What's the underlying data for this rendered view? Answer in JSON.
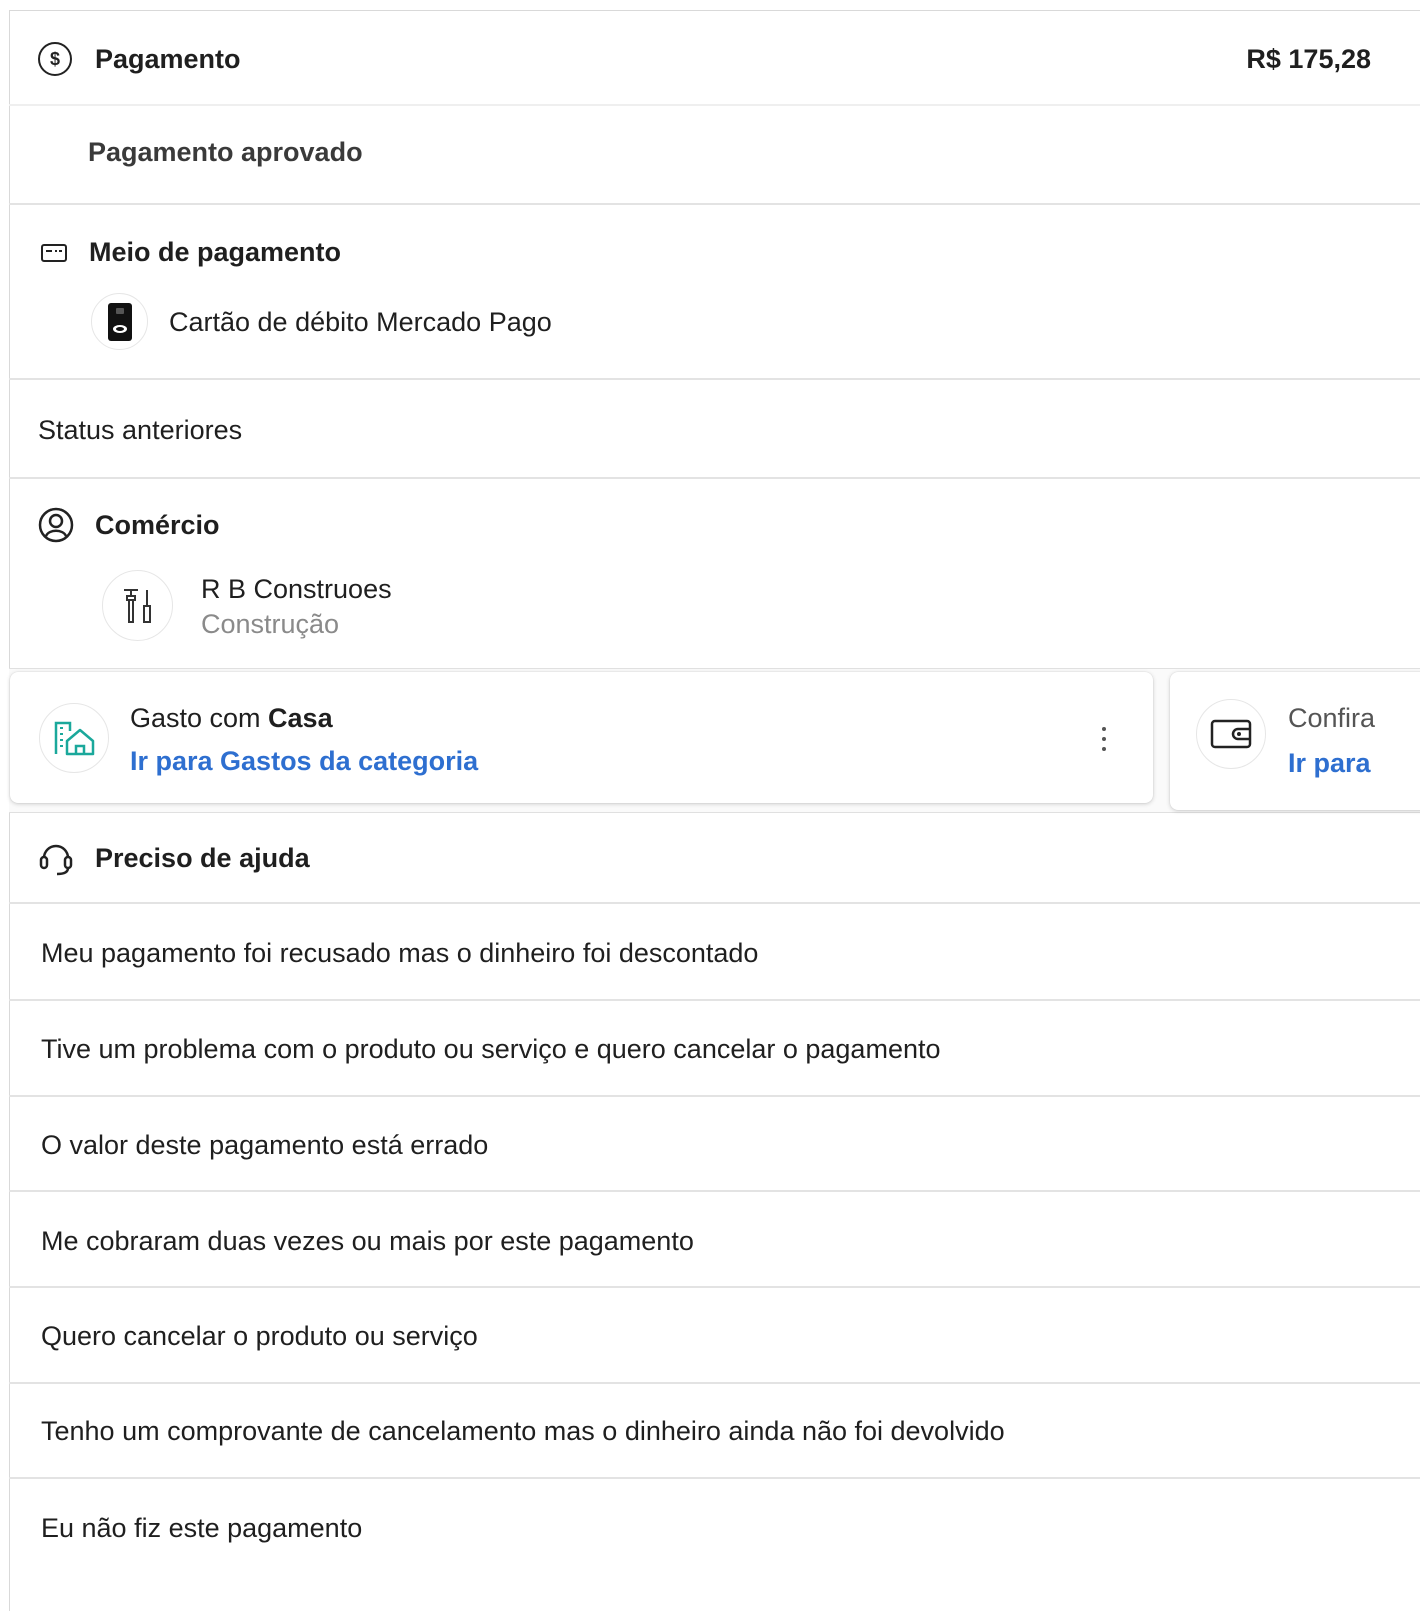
{
  "payment": {
    "title": "Pagamento",
    "amount": "R$ 175,28",
    "status": "Pagamento aprovado"
  },
  "payment_method": {
    "title": "Meio de pagamento",
    "card_name": "Cartão de débito Mercado Pago"
  },
  "previous_status": "Status anteriores",
  "merchant": {
    "title": "Comércio",
    "name": "R B Construoes",
    "category": "Construção"
  },
  "carousel": {
    "card1": {
      "prefix": "Gasto com ",
      "bold": "Casa",
      "link": "Ir para Gastos da categoria"
    },
    "card2": {
      "title": "Confira",
      "link": "Ir para"
    }
  },
  "help": {
    "title": "Preciso de ajuda",
    "items": [
      "Meu pagamento foi recusado mas o dinheiro foi descontado",
      "Tive um problema com o produto ou serviço e quero cancelar o pagamento",
      "O valor deste pagamento está errado",
      "Me cobraram duas vezes ou mais por este pagamento",
      "Quero cancelar o produto ou serviço",
      "Tenho um comprovante de cancelamento mas o dinheiro ainda não foi devolvido",
      "Eu não fiz este pagamento"
    ]
  },
  "colors": {
    "link": "#2e6fd0",
    "teal_icon": "#1aa89b"
  }
}
